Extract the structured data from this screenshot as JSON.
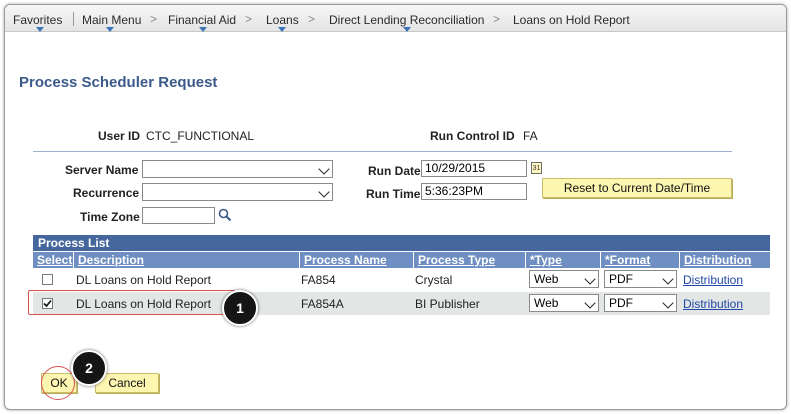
{
  "breadcrumb": {
    "favorites": "Favorites",
    "main_menu": "Main Menu",
    "financial_aid": "Financial Aid",
    "loans": "Loans",
    "direct_lending": "Direct Lending Reconciliation",
    "current": "Loans on Hold Report",
    "separator": ">"
  },
  "page": {
    "title": "Process Scheduler Request"
  },
  "header": {
    "user_id_label": "User ID",
    "user_id_value": "CTC_FUNCTIONAL",
    "run_control_label": "Run Control ID",
    "run_control_value": "FA"
  },
  "form": {
    "server_name_label": "Server Name",
    "server_name_value": "",
    "recurrence_label": "Recurrence",
    "recurrence_value": "",
    "time_zone_label": "Time Zone",
    "time_zone_value": "",
    "run_date_label": "Run Date",
    "run_date_value": "10/29/2015",
    "run_time_label": "Run Time",
    "run_time_value": "5:36:23PM",
    "reset_button": "Reset to Current Date/Time",
    "calendar_icon_glyph": "31"
  },
  "process_list": {
    "title": "Process List",
    "columns": [
      "Select",
      "Description",
      "Process Name",
      "Process Type",
      "*Type",
      "*Format",
      "Distribution"
    ],
    "rows": [
      {
        "selected": false,
        "description": "DL Loans on Hold Report",
        "process_name": "FA854",
        "process_type": "Crystal",
        "type": "Web",
        "format": "PDF",
        "distribution": "Distribution"
      },
      {
        "selected": true,
        "description": "DL Loans on Hold Report",
        "process_name": "FA854A",
        "process_type": "BI Publisher",
        "type": "Web",
        "format": "PDF",
        "distribution": "Distribution"
      }
    ]
  },
  "footer": {
    "ok_button": "OK",
    "cancel_button": "Cancel"
  },
  "callouts": {
    "step1": "1",
    "step2": "2"
  },
  "colors": {
    "title": "#3c5a8a",
    "grid_header": "#45679e",
    "column_header": "#6f8fc2",
    "button_yellow": "#fdf6b0",
    "highlight_red": "#d9534f",
    "link": "#2146a8"
  }
}
